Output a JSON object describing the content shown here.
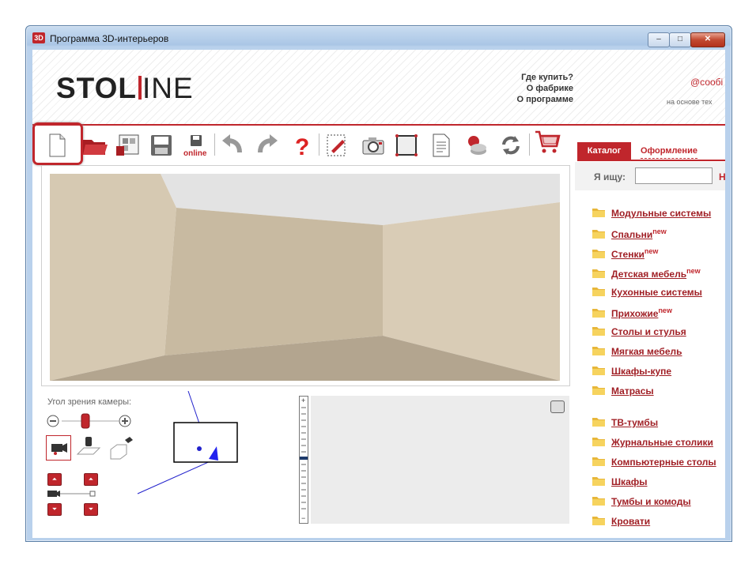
{
  "window": {
    "title": "Программа 3D-интерьеров",
    "icon_text": "3D",
    "min": "–",
    "max": "□",
    "close": "✕"
  },
  "header": {
    "logo_left": "STOL",
    "logo_right": "INE",
    "links": [
      "Где купить?",
      "О фабрике",
      "О программе"
    ],
    "email": "@сообі",
    "based_on": "на основе тех"
  },
  "toolbar": {
    "online_label": "online",
    "icons": [
      "new-document-icon",
      "open-folder-icon",
      "plan-icon",
      "save-icon",
      "save-online-icon",
      "undo-icon",
      "redo-icon",
      "help-icon",
      "edit-dimensions-icon",
      "camera-icon",
      "frame-icon",
      "report-icon",
      "materials-icon",
      "refresh-icon",
      "cart-icon"
    ]
  },
  "tabs": [
    {
      "label": "Каталог",
      "active": true
    },
    {
      "label": "Оформление",
      "active": false
    }
  ],
  "camera": {
    "label": "Угол зрения камеры:"
  },
  "search": {
    "label": "Я ищу:",
    "value": "",
    "go": "Н"
  },
  "catalog": {
    "new_badge": "new",
    "items": [
      {
        "label": "Модульные системы",
        "new": false
      },
      {
        "label": "Спальни",
        "new": true
      },
      {
        "label": "Стенки",
        "new": true
      },
      {
        "label": "Детская мебель",
        "new": true
      },
      {
        "label": "Кухонные системы",
        "new": false
      },
      {
        "label": "Прихожие",
        "new": true
      },
      {
        "label": "Столы и стулья",
        "new": false
      },
      {
        "label": "Мягкая мебель",
        "new": false
      },
      {
        "label": "Шкафы-купе",
        "new": false
      },
      {
        "label": "Матрасы",
        "new": false
      },
      {
        "label": "ТВ-тумбы",
        "new": false
      },
      {
        "label": "Журнальные столики",
        "new": false
      },
      {
        "label": "Компьютерные столы",
        "new": false
      },
      {
        "label": "Шкафы",
        "new": false
      },
      {
        "label": "Тумбы и комоды",
        "new": false
      },
      {
        "label": "Кровати",
        "new": false
      }
    ]
  },
  "colors": {
    "accent": "#c0262c",
    "wall_light": "#d8cbb4",
    "wall_dark": "#c4b69d",
    "floor": "#b3a58f",
    "ceiling": "#e3e3e3"
  }
}
